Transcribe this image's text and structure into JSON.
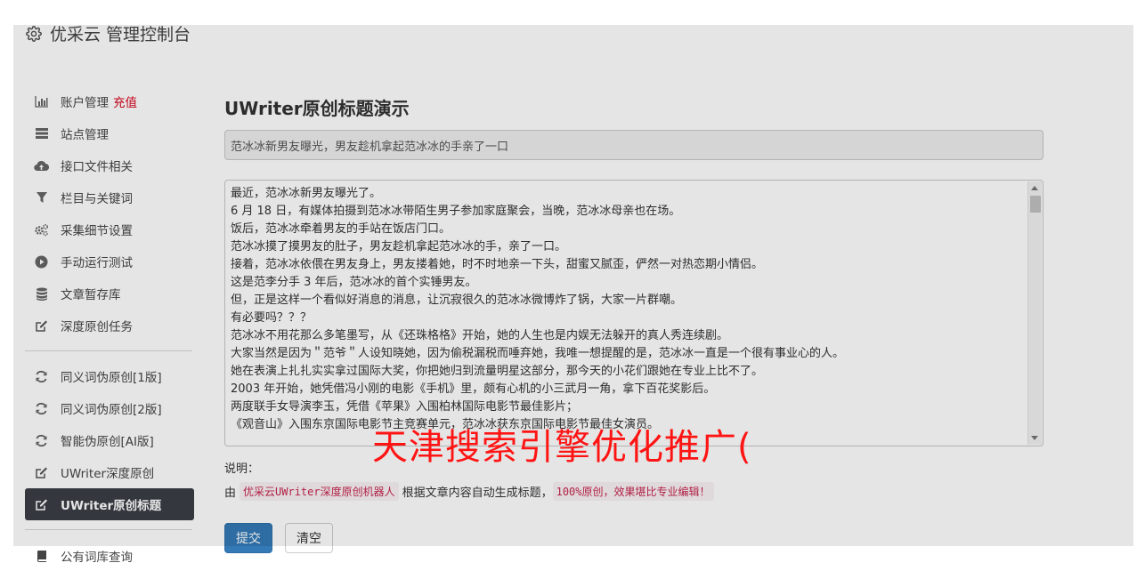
{
  "brand": {
    "title": "优采云 管理控制台",
    "icon": "gear-icon"
  },
  "sidebar": {
    "group1": [
      {
        "icon": "bar-chart-icon",
        "label": "账户管理",
        "accent": "充值"
      },
      {
        "icon": "server-list-icon",
        "label": "站点管理"
      },
      {
        "icon": "cloud-upload-icon",
        "label": "接口文件相关"
      },
      {
        "icon": "filter-icon",
        "label": "栏目与关键词"
      },
      {
        "icon": "cogs-icon",
        "label": "采集细节设置"
      },
      {
        "icon": "play-circle-icon",
        "label": "手动运行测试"
      },
      {
        "icon": "database-icon",
        "label": "文章暂存库"
      },
      {
        "icon": "edit-icon",
        "label": "深度原创任务"
      }
    ],
    "group2": [
      {
        "icon": "refresh-icon",
        "label": "同义词伪原创[1版]"
      },
      {
        "icon": "refresh-icon",
        "label": "同义词伪原创[2版]"
      },
      {
        "icon": "refresh-icon",
        "label": "智能伪原创[AI版]"
      },
      {
        "icon": "edit-icon",
        "label": "UWriter深度原创"
      },
      {
        "icon": "edit-icon",
        "label": "UWriter原创标题",
        "active": true
      }
    ],
    "bottom": {
      "icon": "book-icon",
      "label": "公有词库查询"
    }
  },
  "main": {
    "title": "UWriter原创标题演示",
    "title_value": "范冰冰新男友曝光，男友趁机拿起范冰冰的手亲了一口",
    "content_lines": [
      "最近，范冰冰新男友曝光了。",
      "6 月 18 日，有媒体拍摄到范冰冰带陌生男子参加家庭聚会，当晚，范冰冰母亲也在场。",
      "饭后，范冰冰牵着男友的手站在饭店门口。",
      "范冰冰摸了摸男友的肚子，男友趁机拿起范冰冰的手，亲了一口。",
      "接着，范冰冰依偎在男友身上，男友搂着她，时不时地亲一下头，甜蜜又腻歪，俨然一对热恋期小情侣。",
      "这是范李分手 3 年后，范冰冰的首个实锤男友。",
      "但，正是这样一个看似好消息的消息，让沉寂很久的范冰冰微博炸了锅，大家一片群嘲。",
      "有必要吗？？？",
      "范冰冰不用花那么多笔墨写，从《还珠格格》开始，她的人生也是内娱无法躲开的真人秀连续剧。",
      "大家当然是因为＂范爷＂人设知晓她，因为偷税漏税而唾弃她，我唯一想提醒的是，范冰冰一直是一个很有事业心的人。",
      "她在表演上扎扎实实拿过国际大奖，你把她归到流量明星这部分，那今天的小花们跟她在专业上比不了。",
      "2003 年开始，她凭借冯小刚的电影《手机》里，颇有心机的小三武月一角，拿下百花奖影后。",
      "两度联手女导演李玉，凭借《苹果》入围柏林国际电影节最佳影片；",
      "《观音山》入围东京国际电影节主竞赛单元，范冰冰获东京国际电影节最佳女演员。"
    ],
    "note_label": "说明：",
    "note_prefix": "由",
    "note_highlight1": "优采云UWriter深度原创机器人",
    "note_middle": "根据文章内容自动生成标题，",
    "note_highlight2": "100%原创，效果堪比专业编辑！",
    "submit_label": "提交",
    "clear_label": "清空"
  },
  "watermark": "天津搜索引擎优化推广(",
  "colors": {
    "accent_red": "#d9001b",
    "active_bg": "#3a3f46",
    "primary": "#337ab7",
    "watermark": "#ff1414"
  }
}
